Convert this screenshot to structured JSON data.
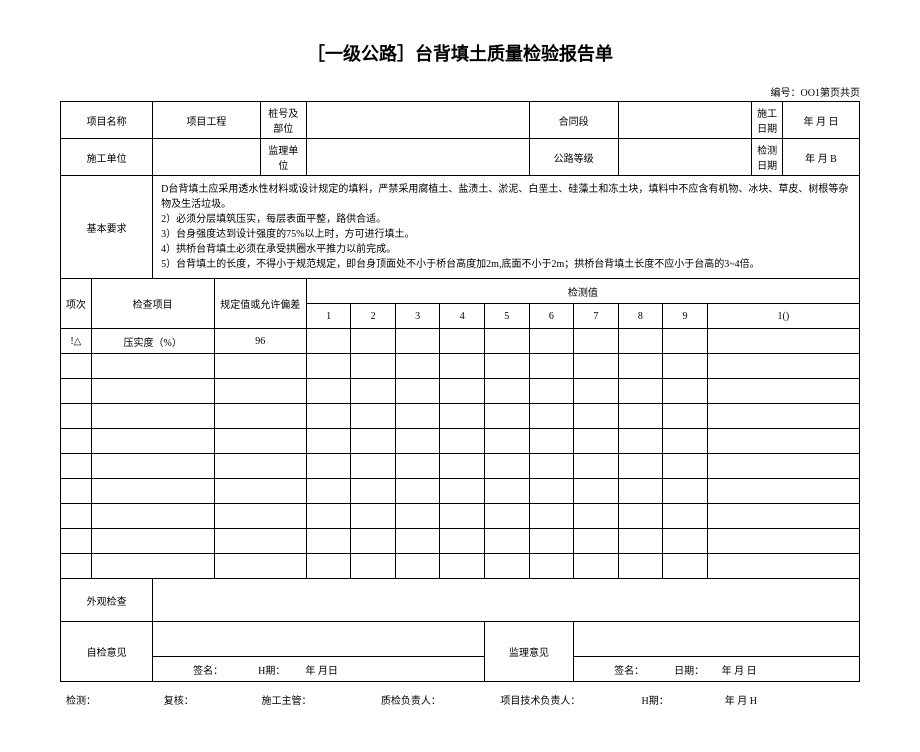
{
  "title": "［一级公路］台背填土质量检验报告单",
  "doc_number": "编号：OO1第页共页",
  "header": {
    "project_name_label": "项目名称",
    "project_eng_label": "项目工程",
    "stake_label": "桩号及部位",
    "contract_label": "合同段",
    "construct_date_label": "施工日期",
    "date_value1": "年  月  日",
    "construct_unit_label": "施工单位",
    "supervise_unit_label": "监理单位",
    "road_grade_label": "公路等级",
    "inspect_date_label": "检测日期",
    "date_value2": "年  月  B"
  },
  "basic_req": {
    "label": "基本要求",
    "text": "D台背填土应采用透水性材料或设计规定的填料，严禁采用腐植土、盐渍土、淤泥、白垩土、硅藻土和冻土块，填料中不应含有机物、冰块、草皮、树根等杂物及生活垃圾。\n2）必须分层填筑压实，每层表面平整，路供合适。\n3）台身强度达到设计强度的75%以上时，方可进行填土。\n4）拱桥台背填土必须在承受拱圈水平推力以前完成。\n5）台背填土的长度，不得小于规范规定，即台身顶面处不小于桥台高度加2m,底面不小于2m；拱桥台背填土长度不应小于台高的3~4倍。"
  },
  "table_header": {
    "seq": "项次",
    "check_item": "检查项目",
    "spec_val": "规定值或允许偏差",
    "measure": "检测值",
    "cols": [
      "1",
      "2",
      "3",
      "4",
      "5",
      "6",
      "7",
      "8",
      "9",
      "1()"
    ]
  },
  "rows": [
    {
      "seq": "!△",
      "item": "压实度（%）",
      "spec": "96"
    }
  ],
  "bottom": {
    "appearance_label": "外观检查",
    "self_opinion_label": "自检意见",
    "supervise_opinion_label": "监理意见",
    "sign1": "签名：",
    "h_period1": "H期：",
    "date_fill1": "年   月日",
    "sign2": "签名：",
    "date_label2": "日期：",
    "date_fill2": "年  月  日"
  },
  "footer": {
    "inspect": "检测：",
    "review": "复核：",
    "chief": "施工主管：",
    "qc": "质检负责人：",
    "tech": "项目技术负责人：",
    "h_period": "H期：",
    "date": "年  月   H"
  }
}
